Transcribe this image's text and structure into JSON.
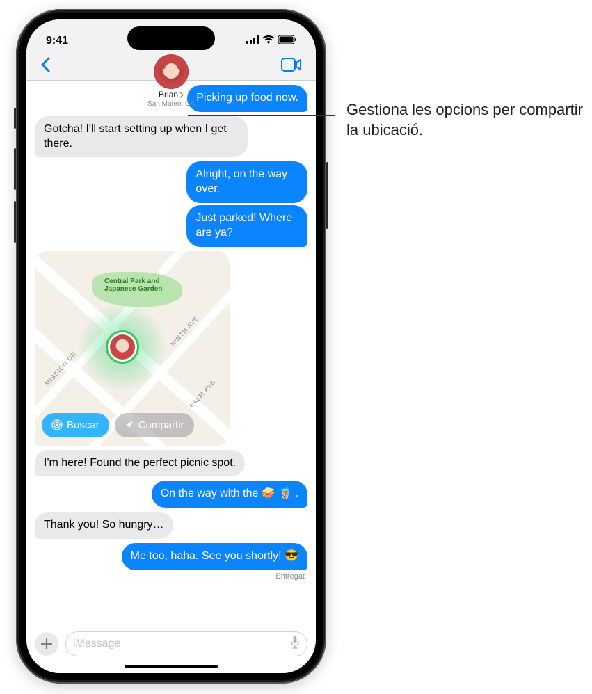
{
  "status": {
    "time": "9:41"
  },
  "header": {
    "contact_name": "Brian",
    "contact_location": "San Mateo, CA"
  },
  "messages": [
    {
      "type": "sent",
      "text": "Picking up food now."
    },
    {
      "type": "received",
      "text": "Gotcha! I'll start setting up when I get there."
    },
    {
      "type": "sent",
      "text": "Alright, on the way over."
    },
    {
      "type": "sent",
      "text": "Just parked! Where are ya?"
    },
    {
      "type": "received",
      "text": "I'm here! Found the perfect picnic spot."
    },
    {
      "type": "sent",
      "text": "On the way with the 🥪 🧋 ."
    },
    {
      "type": "received",
      "text": "Thank you! So hungry…"
    },
    {
      "type": "sent",
      "text": "Me too, haha. See you shortly! 😎"
    }
  ],
  "map": {
    "park_name": "Central Park and\nJapanese Garden",
    "street_ninth": "NINTH AVE",
    "street_palm": "PALM AVE",
    "street_mission": "MISSION DR",
    "find_label": "Buscar",
    "share_label": "Compartir"
  },
  "delivered_label": "Entregat",
  "input": {
    "placeholder": "iMessage"
  },
  "callout": "Gestiona les opcions per compartir la ubicació."
}
